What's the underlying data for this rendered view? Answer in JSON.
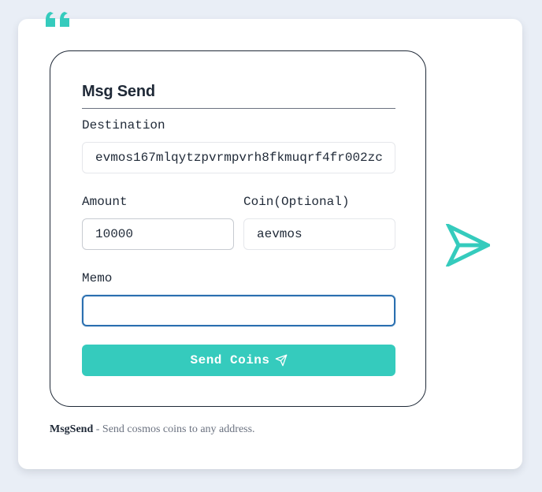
{
  "form": {
    "title": "Msg Send",
    "destination": {
      "label": "Destination",
      "value": "evmos167mlqytzpvrmpvrh8fkmuqrf4fr002zc"
    },
    "amount": {
      "label": "Amount",
      "value": "10000"
    },
    "coin": {
      "label": "Coin(Optional)",
      "value": "aevmos"
    },
    "memo": {
      "label": "Memo",
      "value": ""
    },
    "submit_label": "Send Coins"
  },
  "caption": {
    "name": "MsgSend",
    "separator": " - ",
    "description": "Send cosmos coins to any address."
  },
  "icons": {
    "quote": "quote-icon",
    "send_small": "paper-plane-icon",
    "send_large": "paper-plane-icon"
  },
  "colors": {
    "accent": "#35cbbd",
    "focus_border": "#2a6fb0",
    "text": "#1f2937",
    "muted": "#6b7280",
    "page_background": "#e9eef6"
  }
}
